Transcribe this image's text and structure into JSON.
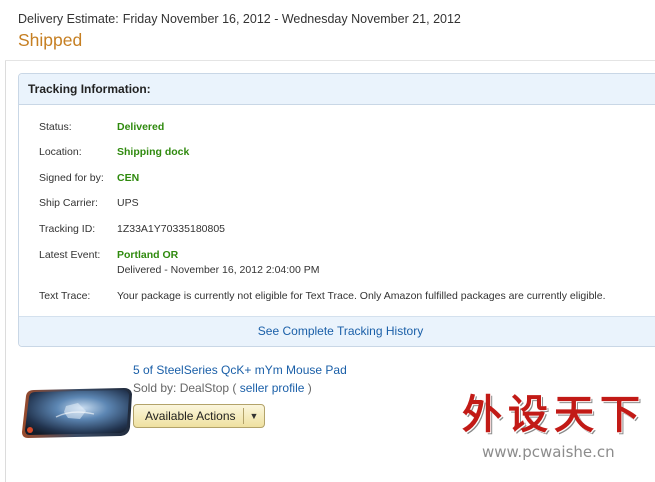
{
  "delivery": {
    "label": "Delivery Estimate:",
    "value": "Friday November 16, 2012 - Wednesday November 21, 2012"
  },
  "shipment_status": "Shipped",
  "tracking": {
    "title": "Tracking Information:",
    "rows": {
      "status": {
        "key": "Status:",
        "value": "Delivered"
      },
      "location": {
        "key": "Location:",
        "value": "Shipping dock"
      },
      "signed": {
        "key": "Signed for by:",
        "value": "CEN"
      },
      "carrier": {
        "key": "Ship Carrier:",
        "value": "UPS"
      },
      "tracking_id": {
        "key": "Tracking ID:",
        "value": "1Z33A1Y70335180805"
      },
      "latest": {
        "key": "Latest Event:",
        "value": "Portland OR",
        "detail": "Delivered - November 16, 2012 2:04:00 PM"
      },
      "text_trace": {
        "key": "Text Trace:",
        "value": "Your package is currently not eligible for Text Trace. Only Amazon fulfilled packages are currently eligible."
      }
    },
    "history_link": "See Complete Tracking History"
  },
  "product": {
    "title": "5 of SteelSeries QcK+ mYm Mouse Pad",
    "sold_by_prefix": "Sold by: DealStop (",
    "seller_profile": "seller profile",
    "sold_by_suffix": ")",
    "actions_label": "Available Actions"
  },
  "watermark": {
    "chars": [
      "外",
      "设",
      "天",
      "下"
    ],
    "url": "www.pcwaishe.cn"
  },
  "colors": {
    "shipped": "#c67f22",
    "green_value": "#2f8a0e",
    "link": "#1a5fa8",
    "header_bg": "#eaf3fc",
    "watermark_red": "#c21a16"
  },
  "icons": {
    "actions_caret": "caret-down-icon"
  }
}
